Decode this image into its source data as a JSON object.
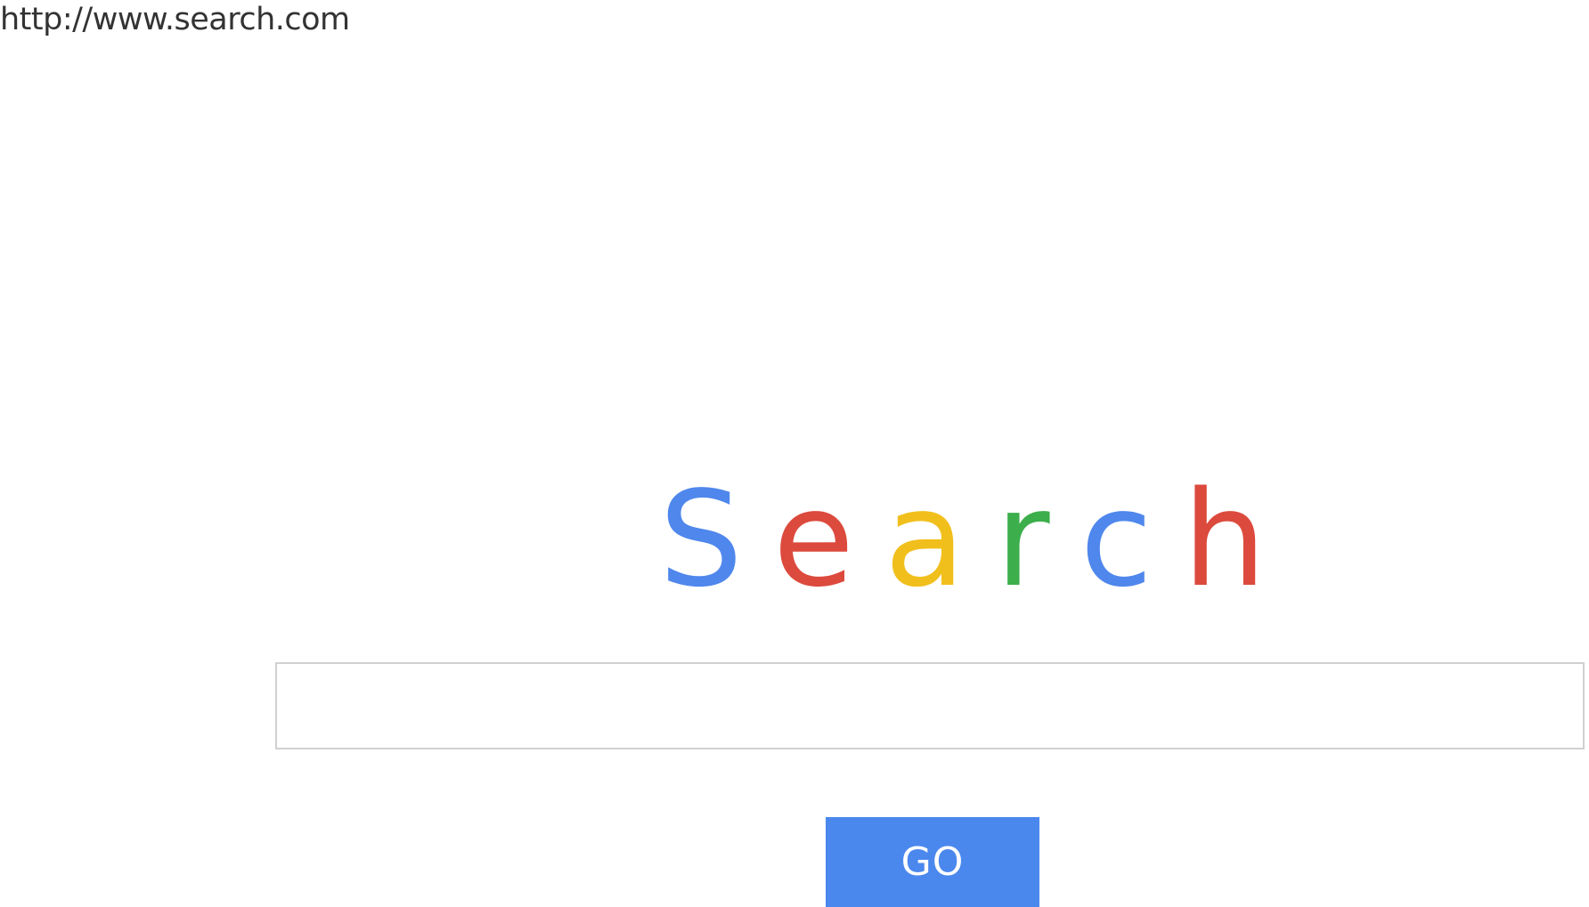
{
  "address_bar": {
    "url": "http://www.search.com"
  },
  "logo": {
    "letters": [
      {
        "char": "S",
        "color": "#4f87ec"
      },
      {
        "char": "e",
        "color": "#dc4a3d"
      },
      {
        "char": "a",
        "color": "#f1bf1c"
      },
      {
        "char": "r",
        "color": "#3cae4b"
      },
      {
        "char": "c",
        "color": "#4f87ec"
      },
      {
        "char": "h",
        "color": "#dc4a3d"
      }
    ]
  },
  "search": {
    "value": "",
    "placeholder": ""
  },
  "go_button": {
    "label": "GO",
    "color": "#4b88ee"
  }
}
